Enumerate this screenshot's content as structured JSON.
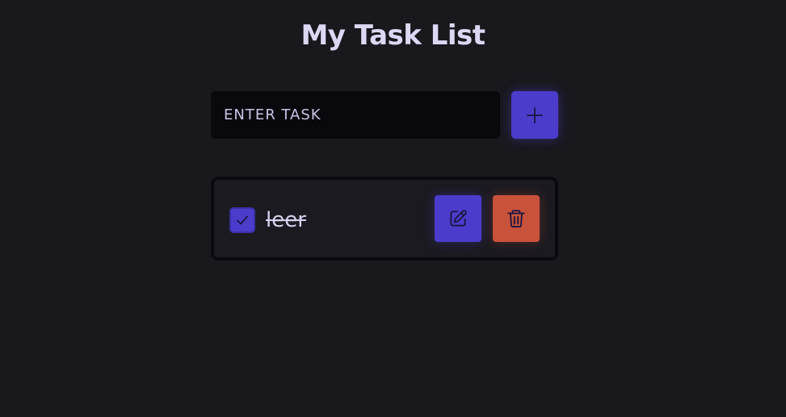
{
  "header": {
    "title": "My Task List"
  },
  "new_task": {
    "placeholder": "ENTER TASK",
    "value": "",
    "add_icon": "plus-icon"
  },
  "tasks": [
    {
      "text": "leer",
      "completed": true,
      "checkbox_icon": "check-icon",
      "edit_icon": "pencil-square-icon",
      "delete_icon": "trash-icon"
    }
  ],
  "colors": {
    "background": "#18181d",
    "accent": "#4b3ccb",
    "danger": "#c9523a",
    "input_background": "#09080d",
    "text": "#d6d3f0"
  }
}
